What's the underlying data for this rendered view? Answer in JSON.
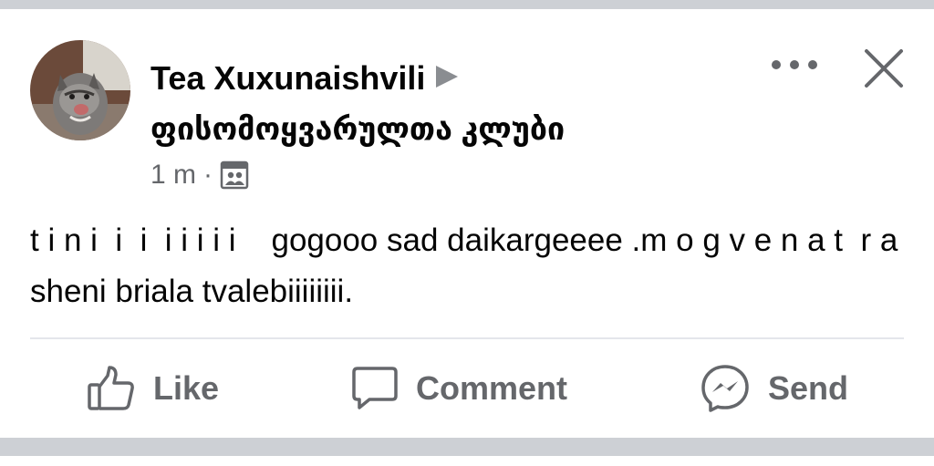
{
  "post": {
    "author": "Tea Xuxunaishvili",
    "group": "ფისომოყვარულთა კლუბი",
    "time": "1 m",
    "separator": "·",
    "audience_icon": "group-privacy-icon",
    "text": "t i n i  i  i  i i i i i    gogooo sad daikargeeee .m o g v e n a t  r a  sheni briala tvalebiiiiiiii."
  },
  "header_icons": [
    "more-options-icon",
    "close-icon"
  ],
  "actions": [
    {
      "label": "Like",
      "icon": "thumbs-up-icon"
    },
    {
      "label": "Comment",
      "icon": "comment-bubble-icon"
    },
    {
      "label": "Send",
      "icon": "messenger-icon"
    }
  ],
  "colors": {
    "text_primary": "#050505",
    "text_secondary": "#65676b",
    "divider": "#e4e6eb",
    "band": "#cdd0d5"
  }
}
